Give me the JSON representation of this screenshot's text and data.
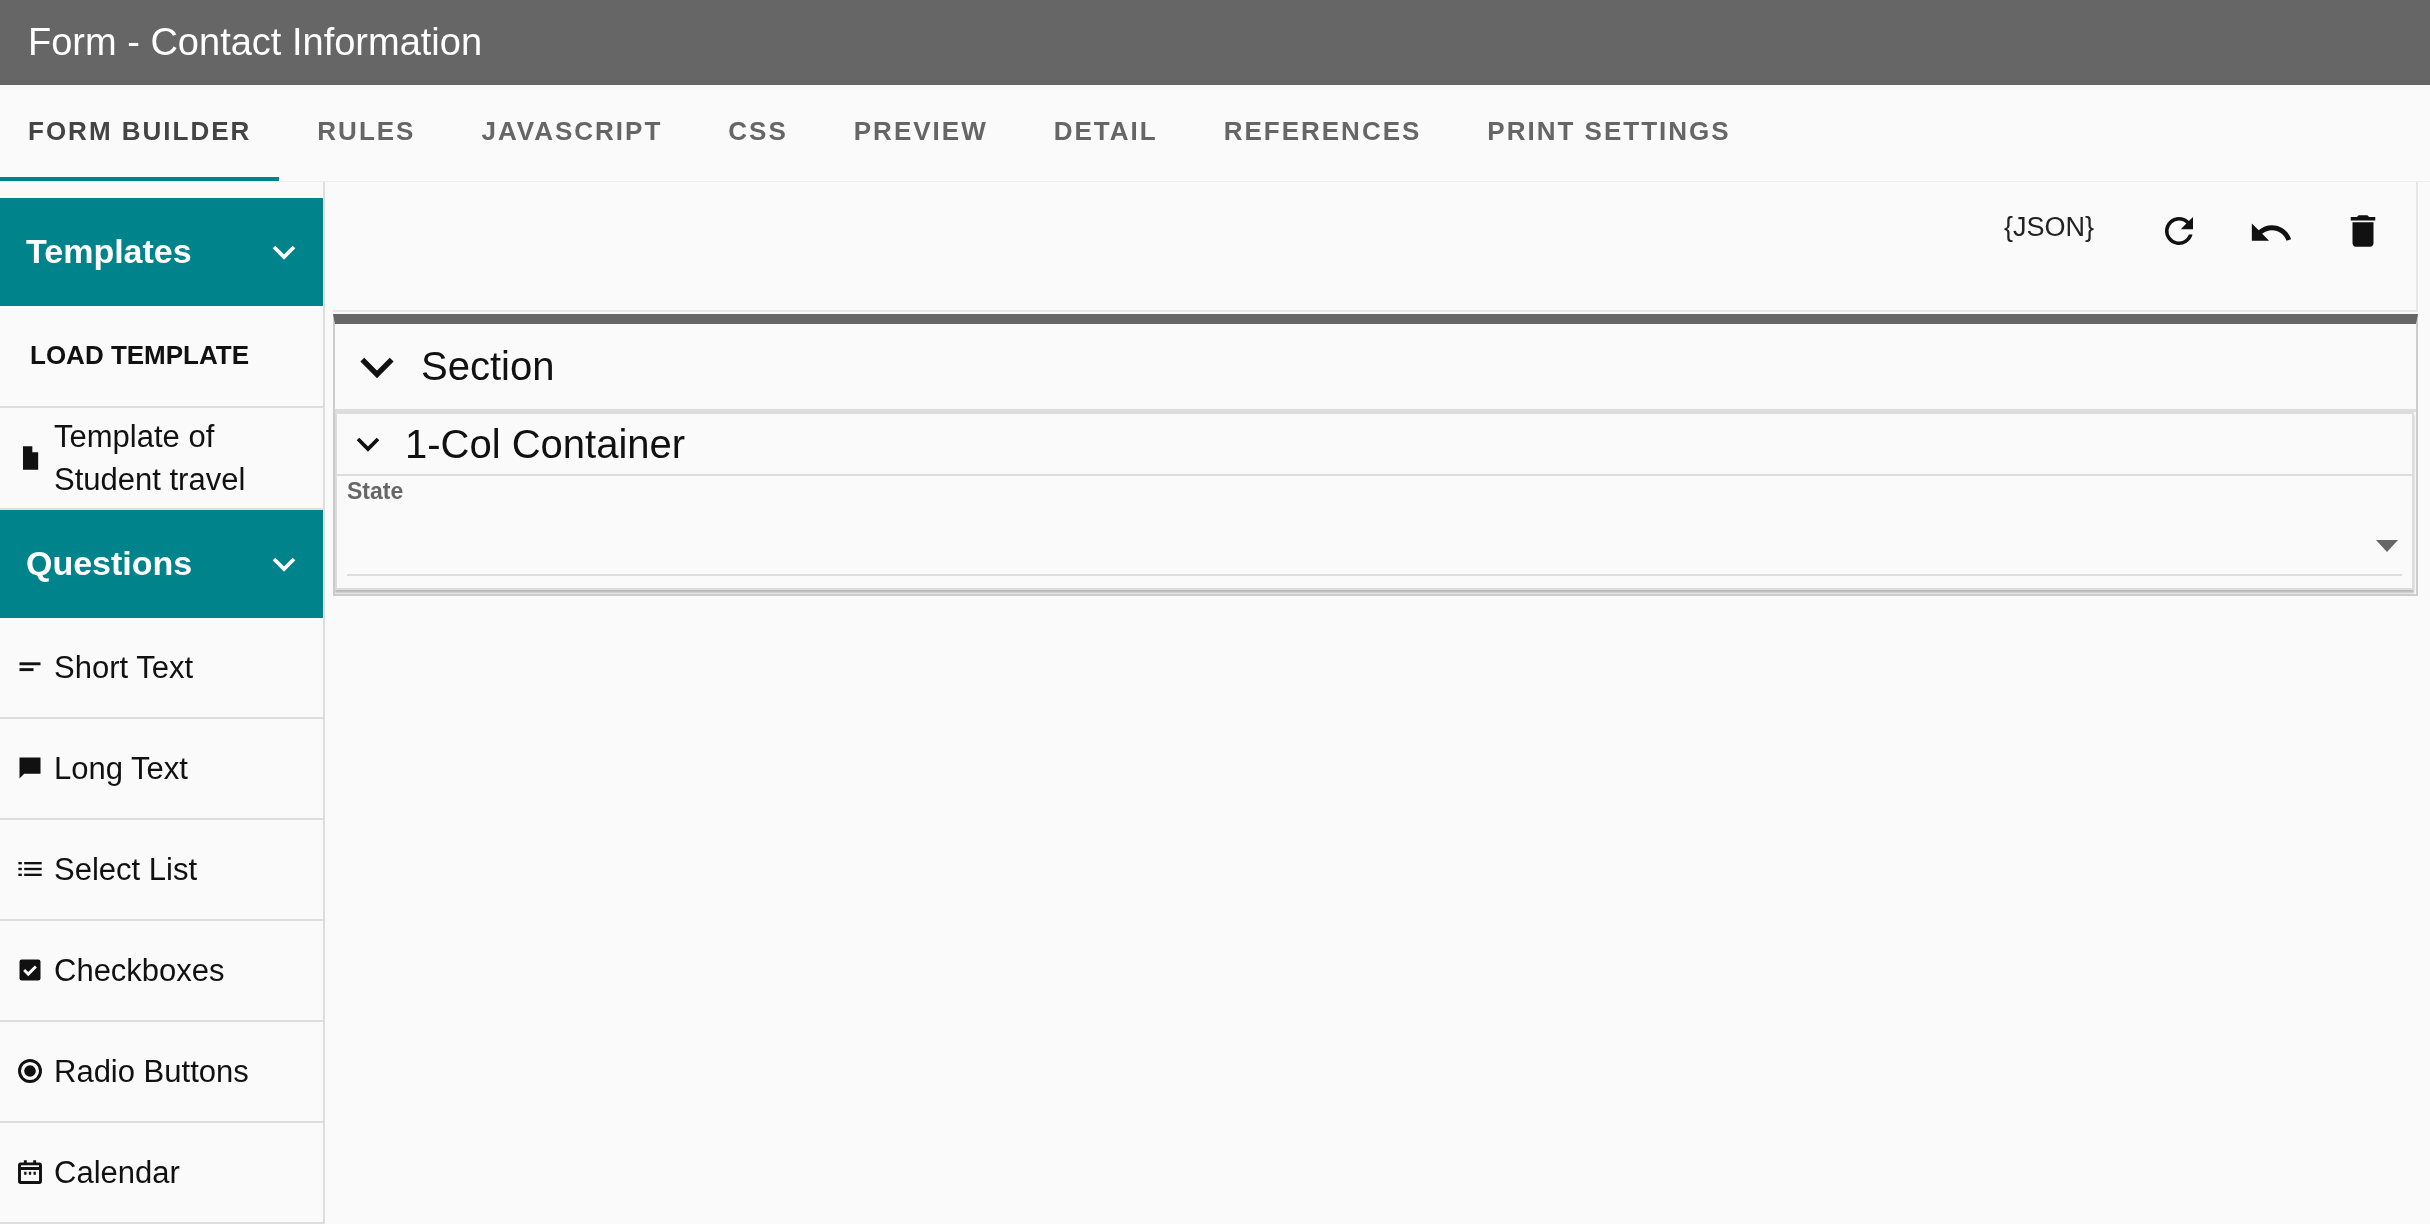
{
  "window": {
    "title": "Form - Contact Information"
  },
  "tabs": [
    {
      "label": "FORM BUILDER",
      "selected": true
    },
    {
      "label": "RULES",
      "selected": false
    },
    {
      "label": "JAVASCRIPT",
      "selected": false
    },
    {
      "label": "CSS",
      "selected": false
    },
    {
      "label": "PREVIEW",
      "selected": false
    },
    {
      "label": "DETAIL",
      "selected": false
    },
    {
      "label": "REFERENCES",
      "selected": false
    },
    {
      "label": "PRINT SETTINGS",
      "selected": false
    }
  ],
  "sidebar": {
    "groups": [
      {
        "title": "Templates",
        "expanded": true,
        "items": [
          {
            "kind": "action",
            "label": "LOAD TEMPLATE"
          },
          {
            "kind": "template",
            "label": "Template of Student travel"
          }
        ]
      },
      {
        "title": "Questions",
        "expanded": true,
        "items": [
          {
            "kind": "short-text",
            "label": "Short Text"
          },
          {
            "kind": "long-text",
            "label": "Long Text"
          },
          {
            "kind": "select-list",
            "label": "Select List"
          },
          {
            "kind": "checkboxes",
            "label": "Checkboxes"
          },
          {
            "kind": "radio",
            "label": "Radio Buttons"
          },
          {
            "kind": "calendar",
            "label": "Calendar"
          }
        ]
      }
    ]
  },
  "toolbar": {
    "json_button": "{JSON}"
  },
  "section": {
    "title": "Section",
    "expanded": true,
    "container": {
      "title": "1-Col Container",
      "expanded": true,
      "field": {
        "label": "State"
      }
    }
  }
}
